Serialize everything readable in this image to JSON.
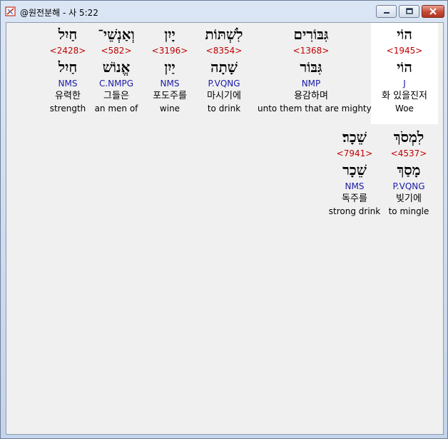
{
  "window": {
    "title": "@원전분해 - 사 5:22"
  },
  "words": [
    {
      "hebrew": "הוֹי",
      "strong": "<1945>",
      "lemma": "הוֹי",
      "morph": "J",
      "korean": "화 있을진저",
      "english": "Woe"
    },
    {
      "hebrew": "גִּבּוֹרִים",
      "strong": "<1368>",
      "lemma": "גִּבּוֹר",
      "morph": "NMP",
      "korean": "용감하며",
      "english": "unto them that are mighty"
    },
    {
      "hebrew": "לִשְׁתּוֹת",
      "strong": "<8354>",
      "lemma": "שָׁתָה",
      "morph": "P.VQNG",
      "korean": "마시기에",
      "english": "to drink"
    },
    {
      "hebrew": "יָיִן",
      "strong": "<3196>",
      "lemma": "יַיִן",
      "morph": "NMS",
      "korean": "포도주를",
      "english": "wine"
    },
    {
      "hebrew": "וְאַנְשֵׁי־",
      "strong": "<582>",
      "lemma": "אֱנוֹשׁ",
      "morph": "C.NMPG",
      "korean": "그들은",
      "english": "an men of"
    },
    {
      "hebrew": "חַיִל",
      "strong": "<2428>",
      "lemma": "חַיִל",
      "morph": "NMS",
      "korean": "유력한",
      "english": "strength"
    },
    {
      "hebrew": "לִמְסֹךְ",
      "strong": "<4537>",
      "lemma": "מָסַךְ",
      "morph": "P.VQNG",
      "korean": "빚기에",
      "english": "to mingle"
    },
    {
      "hebrew": "שֵׁכָר׃",
      "strong": "<7941>",
      "lemma": "שֵׁכָר",
      "morph": "NMS",
      "korean": "독주를",
      "english": "strong drink"
    }
  ]
}
